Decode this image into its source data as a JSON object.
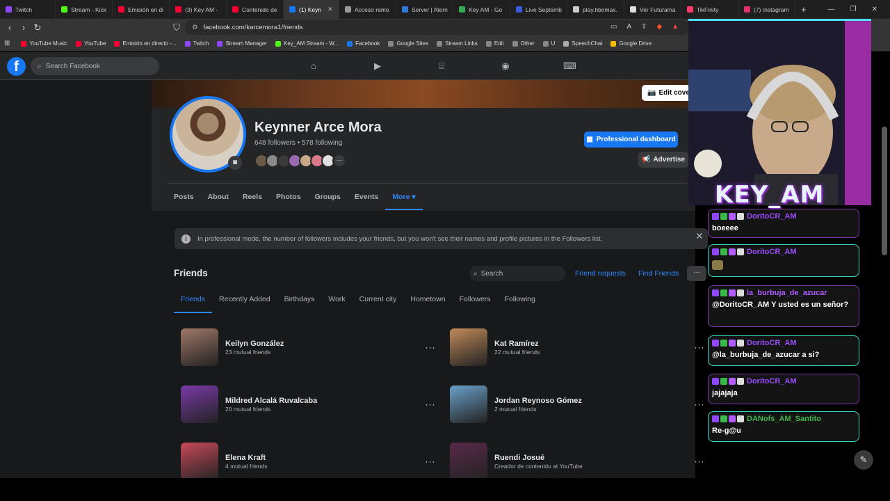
{
  "browser": {
    "tabs": [
      {
        "label": "Twitch",
        "color": "#9146ff"
      },
      {
        "label": "Stream - Kick",
        "color": "#53fc18"
      },
      {
        "label": "Emisión en di",
        "color": "#ff0033"
      },
      {
        "label": "(3) Key AM -",
        "color": "#ff0033"
      },
      {
        "label": "Contenido de",
        "color": "#ff0033"
      },
      {
        "label": "(1) Keyn",
        "color": "#1877f2",
        "active": true
      },
      {
        "label": "Acceso remo",
        "color": "#999999"
      },
      {
        "label": "Server | Atern",
        "color": "#2e7bd6"
      },
      {
        "label": "Key AM - Go",
        "color": "#34a853"
      },
      {
        "label": "Live Septemb",
        "color": "#3b5bdb"
      },
      {
        "label": "play.hbomax.",
        "color": "#cccccc"
      },
      {
        "label": "Ver Futurama",
        "color": "#dddddd"
      },
      {
        "label": "TikFinity",
        "color": "#ff3b6b"
      },
      {
        "label": "(7) Instagram",
        "color": "#e1306c"
      }
    ],
    "url": "facebook.com/karcemora1/friends",
    "bookmarks": [
      {
        "label": "YouTube Music",
        "color": "#ff0033"
      },
      {
        "label": "YouTube",
        "color": "#ff0033"
      },
      {
        "label": "Emisión en directo -...",
        "color": "#ff0033"
      },
      {
        "label": "Twitch",
        "color": "#9146ff"
      },
      {
        "label": "Stream Manager",
        "color": "#9146ff"
      },
      {
        "label": "Key_AM Stream - W...",
        "color": "#53fc18"
      },
      {
        "label": "Facebook",
        "color": "#1877f2"
      },
      {
        "label": "Google Sites",
        "color": "#888888"
      },
      {
        "label": "Stream Links",
        "color": "#888888"
      },
      {
        "label": "Edit",
        "color": "#888888"
      },
      {
        "label": "Other",
        "color": "#888888"
      },
      {
        "label": "U",
        "color": "#888888"
      },
      {
        "label": "SpeechChat",
        "color": "#aaaaaa"
      },
      {
        "label": "Google Drive",
        "color": "#fbbc04"
      }
    ]
  },
  "fb": {
    "search_placeholder": "Search Facebook",
    "profile": {
      "name": "Keynner Arce Mora",
      "followers": "648 followers • 578 following",
      "edit_cover": "Edit cover",
      "pro_dashboard": "Professional dashboard",
      "advertise": "Advertise"
    },
    "tabs": [
      "Posts",
      "About",
      "Reels",
      "Photos",
      "Groups",
      "Events",
      "More ▾"
    ],
    "info": "In professional mode, the number of followers includes your friends, but you won't see their names and profile pictures in the Followers list.",
    "friends": {
      "title": "Friends",
      "search_placeholder": "Search",
      "friend_requests": "Friend requests",
      "find_friends": "Find Friends",
      "tabs": [
        "Friends",
        "Recently Added",
        "Birthdays",
        "Work",
        "Current city",
        "Hometown",
        "Followers",
        "Following"
      ],
      "list": [
        {
          "name": "Keilyn González",
          "sub": "23 mutual friends",
          "color": "#a07868"
        },
        {
          "name": "Kat Ramírez",
          "sub": "22 mutual friends",
          "color": "#c08a5a"
        },
        {
          "name": "Mildred Alcalá Ruvalcaba",
          "sub": "20 mutual friends",
          "color": "#7a3aa8"
        },
        {
          "name": "Jordan Reynoso Gómez",
          "sub": "2 mutual friends",
          "color": "#6aa0c8"
        },
        {
          "name": "Elena Kraft",
          "sub": "4 mutual friends",
          "color": "#c84a5a"
        },
        {
          "name": "Ruendi Josué",
          "sub": "Creador de contenido at YouTube",
          "color": "#5a2a4a"
        }
      ]
    }
  },
  "stream": {
    "overlay_name": "KEY_AM",
    "chat": [
      {
        "user": "DoritoCR_AM",
        "msg": "boeeee",
        "color": "#9b4dff",
        "border": "#7a3aa8"
      },
      {
        "user": "DoritoCR_AM",
        "msg": "",
        "color": "#9b4dff",
        "border": "#3ad6c8"
      },
      {
        "user": "la_burbuja_de_azucar",
        "msg": "@DoritoCR_AM Y usted es un señor?",
        "color": "#b05cff",
        "border": "#7a3aa8"
      },
      {
        "user": "DoritoCR_AM",
        "msg": "@la_burbuja_de_azucar a si?",
        "color": "#9b4dff",
        "border": "#3ad6c8"
      },
      {
        "user": "DoritoCR_AM",
        "msg": "jajajaja",
        "color": "#9b4dff",
        "border": "#7a3aa8"
      },
      {
        "user": "DANofs_AM_Santito",
        "msg": "Re-g@u",
        "color": "#3bb84a",
        "border": "#3ad6c8"
      }
    ]
  }
}
